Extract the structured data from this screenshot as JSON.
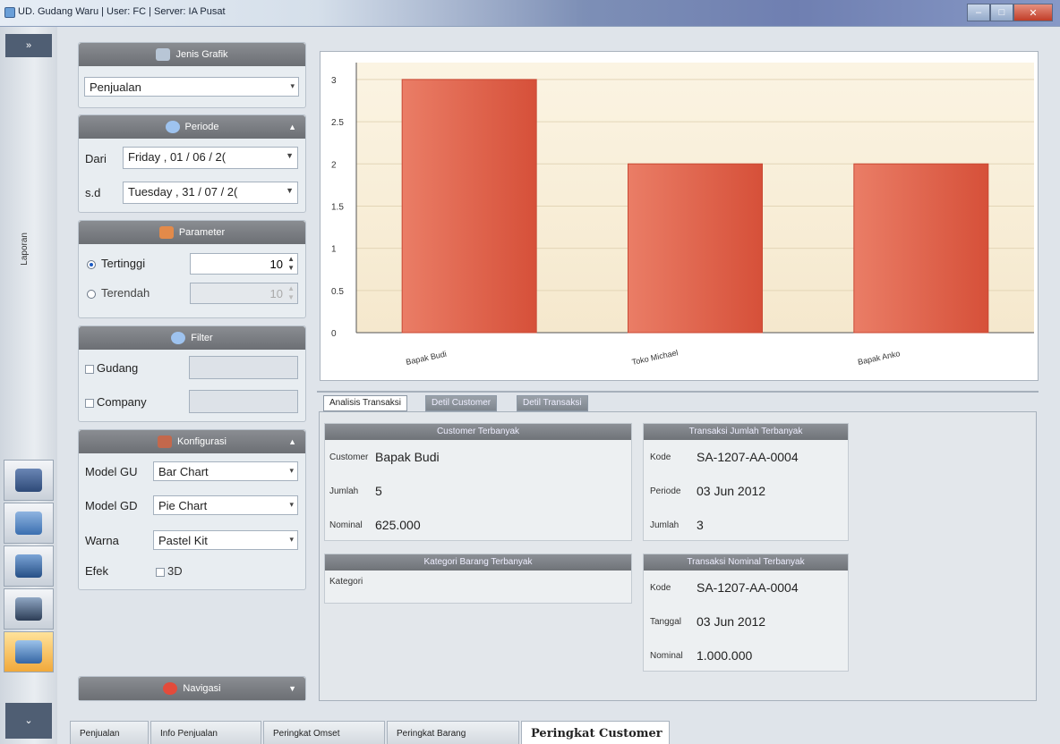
{
  "window": {
    "title": "UD. Gudang Waru  |  User: FC  |  Server: IA Pusat"
  },
  "leftbar": {
    "top_label": "»",
    "vertical_label": "Laporan",
    "bottom_label": "⌄"
  },
  "sidebar": {
    "jenis": {
      "header": "Jenis Grafik",
      "value": "Penjualan"
    },
    "periode": {
      "header": "Periode",
      "dari_label": "Dari",
      "dari_value": "Friday   , 01 / 06 / 2(",
      "sd_label": "s.d",
      "sd_value": "Tuesday  , 31 / 07 / 2("
    },
    "parameter": {
      "header": "Parameter",
      "tertinggi_label": "Tertinggi",
      "tertinggi_value": "10",
      "terendah_label": "Terendah",
      "terendah_value": "10"
    },
    "filter": {
      "header": "Filter",
      "gudang_label": "Gudang",
      "company_label": "Company"
    },
    "konfigurasi": {
      "header": "Konfigurasi",
      "model_gu_label": "Model GU",
      "model_gu_value": "Bar Chart",
      "model_gd_label": "Model GD",
      "model_gd_value": "Pie Chart",
      "warna_label": "Warna",
      "warna_value": "Pastel Kit",
      "efek_label": "Efek",
      "efek_3d_label": "3D"
    },
    "navigasi": {
      "header": "Navigasi"
    }
  },
  "chart_data": {
    "type": "bar",
    "categories": [
      "Bapak Budi",
      "Toko Michael",
      "Bapak Anko"
    ],
    "values": [
      3,
      2,
      2
    ],
    "ylim": [
      0,
      3.2
    ],
    "yticks": [
      "0",
      "0.5",
      "1",
      "1.5",
      "2",
      "2.5",
      "3"
    ],
    "grid": true,
    "bar_color": "#e4604a",
    "title": "",
    "xlabel": "",
    "ylabel": ""
  },
  "inner_tabs": [
    "Analisis Transaksi",
    "Detil Customer",
    "Detil Transaksi"
  ],
  "cards": {
    "customer": {
      "header": "Customer Terbanyak",
      "k1": "Customer",
      "v1": "Bapak Budi",
      "k2": "Jumlah",
      "v2": "5",
      "k3": "Nominal",
      "v3": "625.000"
    },
    "kategori": {
      "header": "Kategori Barang Terbanyak",
      "k1": "Kategori"
    },
    "transaksi_jumlah": {
      "header": "Transaksi Jumlah Terbanyak",
      "k1": "Kode",
      "v1": "SA-1207-AA-0004",
      "k2": "Periode",
      "v2": "03 Jun 2012",
      "k3": "Jumlah",
      "v3": "3"
    },
    "transaksi_nominal": {
      "header": "Transaksi Nominal Terbanyak",
      "k1": "Kode",
      "v1": "SA-1207-AA-0004",
      "k2": "Tanggal",
      "v2": "03 Jun 2012",
      "k3": "Nominal",
      "v3": "1.000.000"
    }
  },
  "bottom_tabs": [
    "Penjualan",
    "Info Penjualan",
    "Peringkat Omset",
    "Peringkat Barang",
    "Peringkat Customer"
  ]
}
